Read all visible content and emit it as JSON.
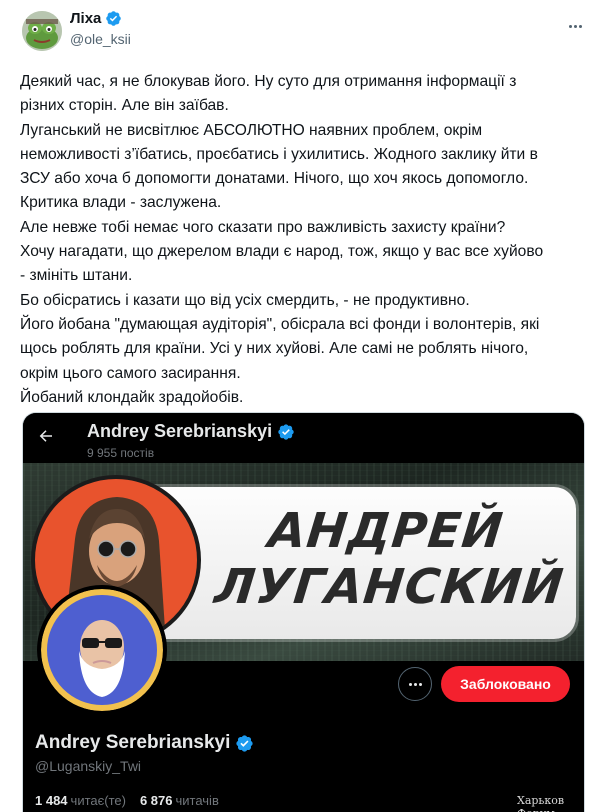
{
  "author": {
    "name": "Ліха",
    "handle": "@ole_ksii",
    "verified": true,
    "avatar_icon": "pepe-frog-avatar"
  },
  "tweet_lines": [
    "Деякий час, я не блокував його. Ну суто для отримання інформації з",
    "різних сторін. Але він заїбав.",
    "Луганський не висвітлює АБСОЛЮТНО наявних проблем, окрім",
    "неможливості з’їбатись, проєбатись і ухилитись. Жодного заклику йти в",
    "ЗСУ або хоча б допомогти донатами. Нічого, що хоч якось допомогло.",
    "Критика влади - заслужена.",
    "Але невже тобі немає чого сказати про важливість захисту країни?",
    "Хочу нагадати, що джерелом влади є народ, тож, якщо у вас все хуйово",
    "- змініть штани.",
    "Бо обісратись і казати що від усіх смердить, - не продуктивно.",
    "Його йобана \"думающая аудіторія\", обісрала всі фонди і волонтерів, які",
    "щось роблять для країни. Усі у них хуйові. Але самі не роблять нічого,",
    "окрім цього самого засирання.",
    "Йобаний клондайк зрадойобів."
  ],
  "screenshot": {
    "header_name": "Andrey Serebrianskyi",
    "posts_count": "9 955 постів",
    "banner_lines": [
      "АНДРЕЙ",
      "ЛУГАНСКИЙ"
    ],
    "profile_name": "Andrey Serebrianskyi",
    "profile_handle": "@Luganskiy_Twi",
    "blocked_label": "Заблоковано",
    "following_count": "1 484",
    "following_label": "читає(те)",
    "followers_count": "6 876",
    "followers_label": "читачів",
    "watermark": "Харьков Форум"
  },
  "colors": {
    "verified_blue": "#1d9bf0",
    "blocked_red": "#f4212e",
    "banner_circle": "#e8532d",
    "avatar_bg": "#4e5fd0",
    "avatar_ring": "#f2c14e"
  }
}
